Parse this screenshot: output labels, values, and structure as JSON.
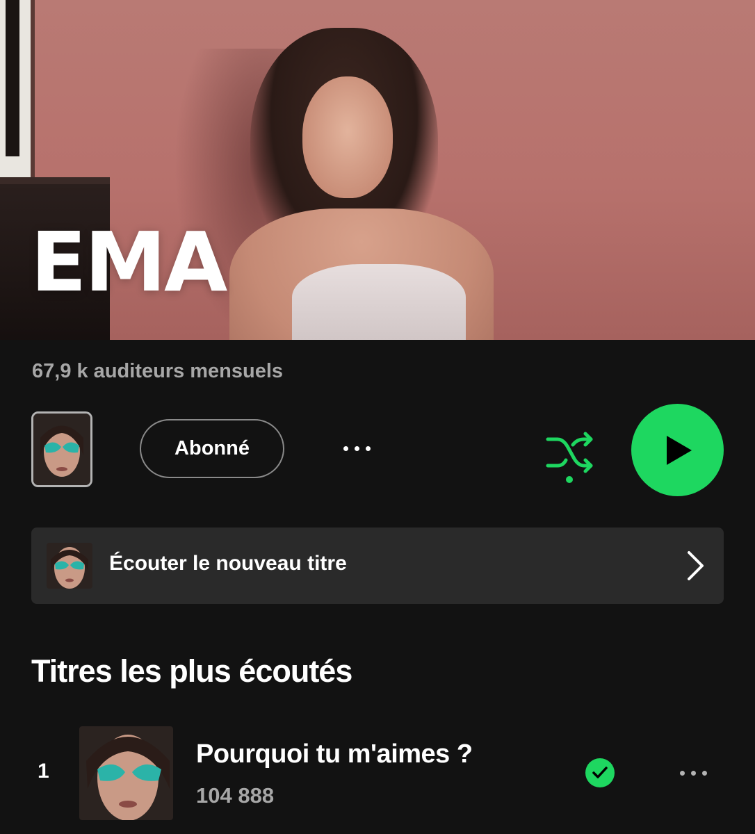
{
  "artist": {
    "name": "EMA",
    "monthly_listeners": "67,9 k auditeurs mensuels"
  },
  "actions": {
    "follow_label": "Abonné",
    "more_icon": "more-horizontal-icon",
    "shuffle_icon": "shuffle-icon",
    "play_icon": "play-icon"
  },
  "new_release": {
    "label": "Écouter le nouveau titre",
    "chevron_icon": "chevron-right-icon"
  },
  "top_tracks": {
    "title": "Titres les plus écoutés",
    "items": [
      {
        "rank": "1",
        "title": "Pourquoi tu m'aimes ?",
        "plays": "104 888",
        "saved": true
      }
    ]
  },
  "colors": {
    "accent": "#1ed760",
    "background": "#121212",
    "card": "#2a2a2a",
    "muted_text": "#a7a7a7"
  }
}
